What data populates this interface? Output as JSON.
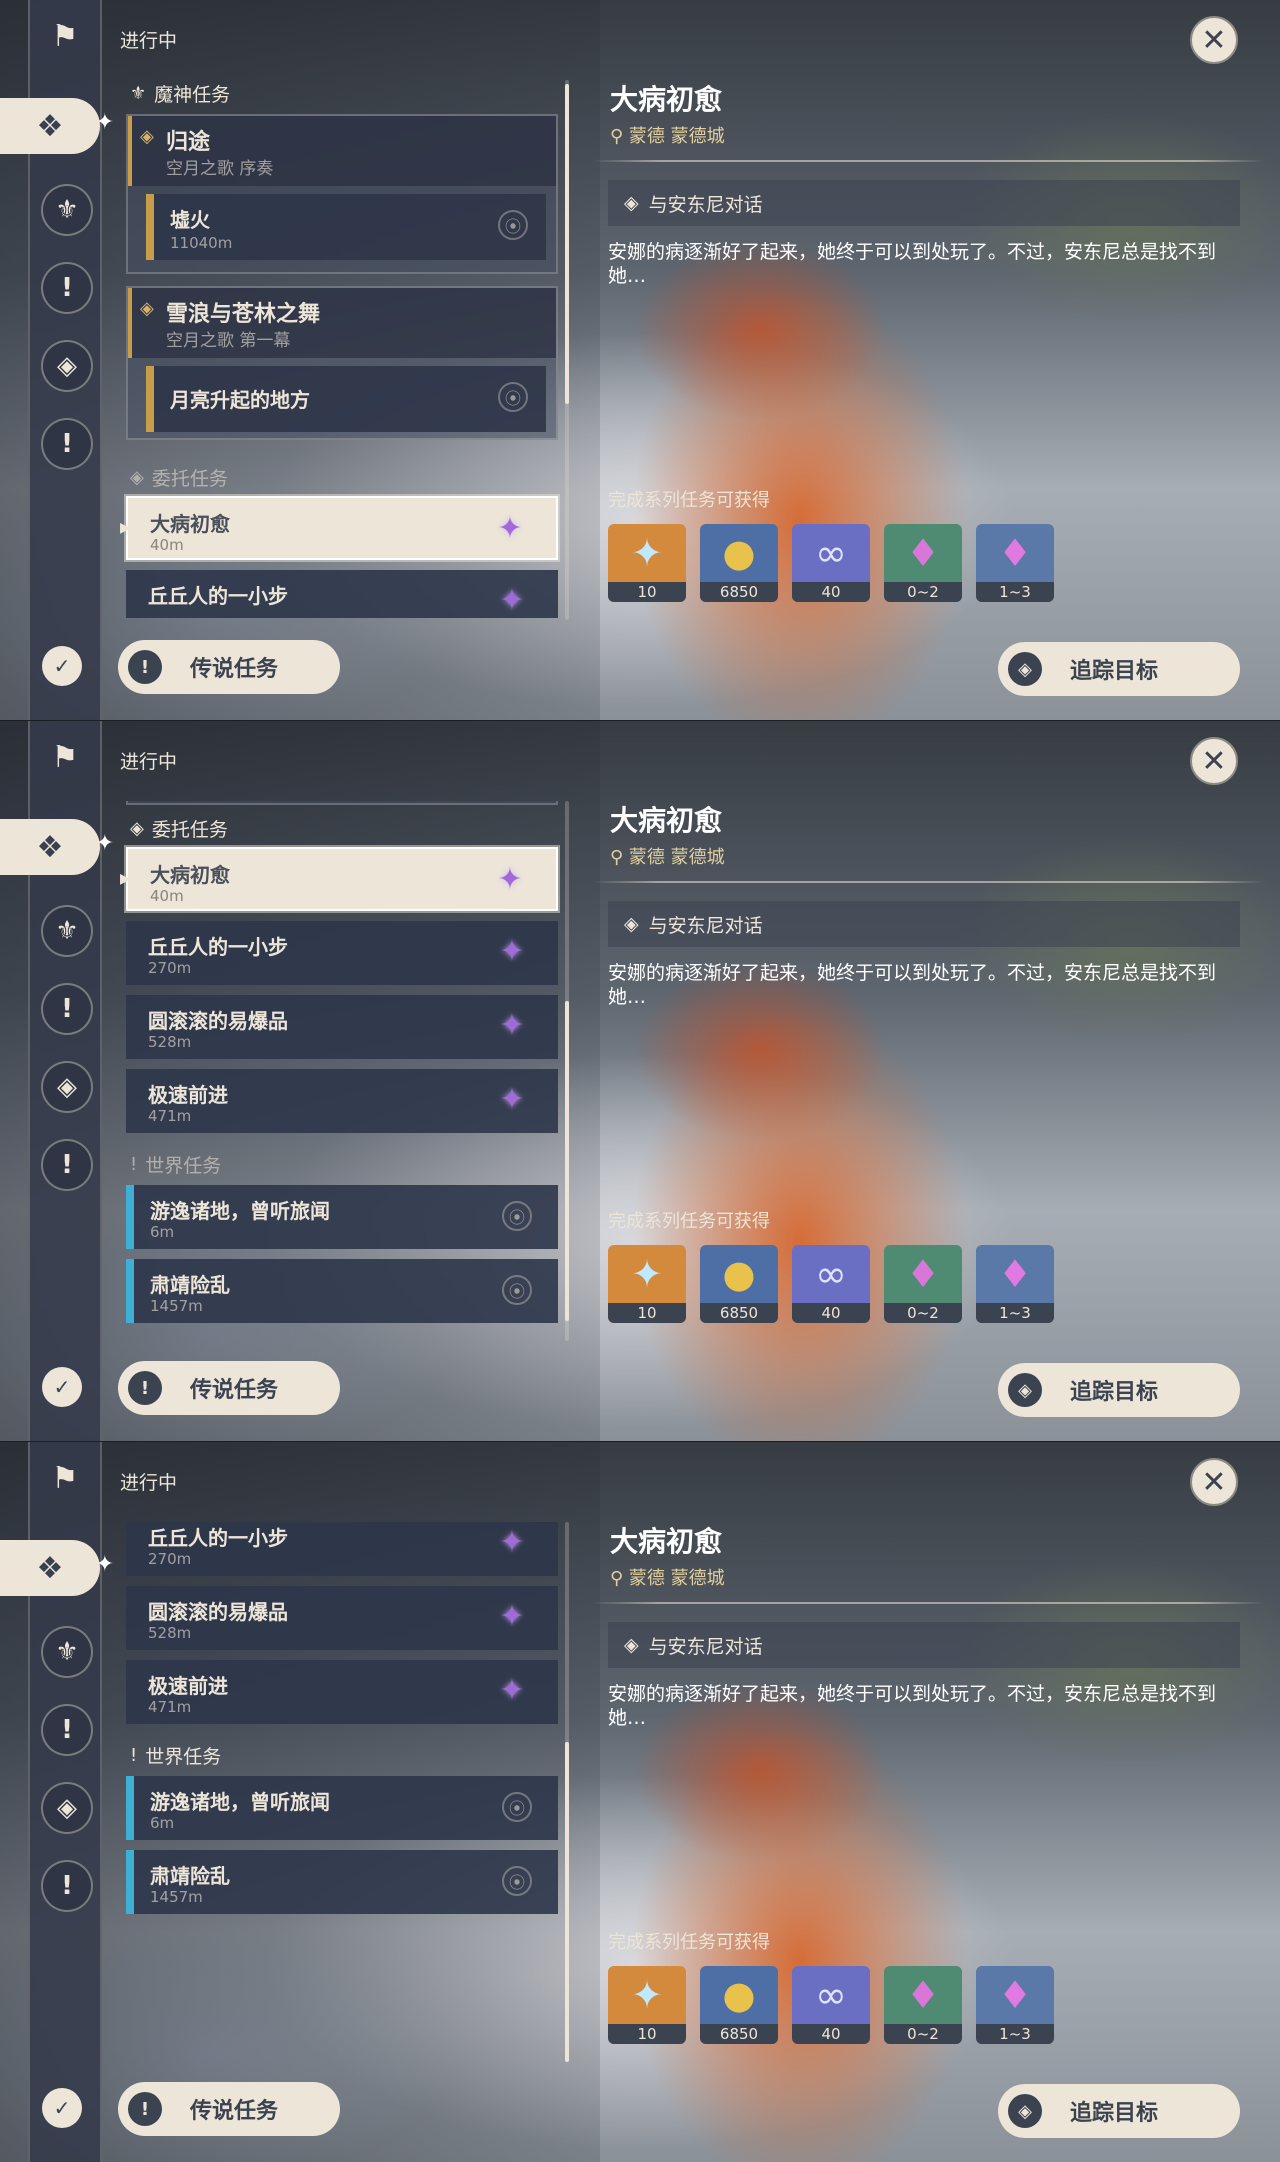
{
  "colors": {
    "cream": "#ece5d8",
    "gold": "#c89d4a",
    "world_blue": "#3eb0d6",
    "panel_dark": "#2e3648",
    "purple_icon": "#a06bd8"
  },
  "status": "进行中",
  "sidebar": {
    "icons": [
      "bookmark-flag-icon",
      "four-diamond-icon",
      "archon-quest-icon",
      "legend-quest-icon",
      "commission-icon",
      "world-quest-icon",
      "quest-log-icon"
    ]
  },
  "sections": {
    "archon": "魔神任务",
    "commission": "委托任务",
    "world": "世界任务"
  },
  "archon_groups": [
    {
      "title": "归途",
      "subtitle": "空月之歌 序奏",
      "sub_title": "墟火",
      "sub_dist": "11040m"
    },
    {
      "title": "雪浪与苍林之舞",
      "subtitle": "空月之歌 第一幕",
      "sub_title": "月亮升起的地方",
      "sub_dist": ""
    }
  ],
  "commissions": [
    {
      "title": "大病初愈",
      "dist": "40m"
    },
    {
      "title": "丘丘人的一小步",
      "dist": "270m"
    },
    {
      "title": "圆滚滚的易爆品",
      "dist": "528m"
    },
    {
      "title": "极速前进",
      "dist": "471m"
    }
  ],
  "world_quests": [
    {
      "title": "游逸诸地，曾听旅闻",
      "dist": "6m"
    },
    {
      "title": "肃靖险乱",
      "dist": "1457m"
    }
  ],
  "legend_button": "传说任务",
  "track_button": "追踪目标",
  "detail": {
    "title": "大病初愈",
    "location": "蒙德 蒙德城",
    "objective": "与安东尼对话",
    "description": "安娜的病逐渐好了起来，她终于可以到处玩了。不过，安东尼总是找不到她…",
    "rewards_label": "完成系列任务可获得",
    "rewards": [
      {
        "icon": "primogem-icon",
        "count": "10"
      },
      {
        "icon": "mora-coin-icon",
        "count": "6850"
      },
      {
        "icon": "adventure-exp-icon",
        "count": "40"
      },
      {
        "icon": "green-crystal-icon",
        "count": "0~2"
      },
      {
        "icon": "purple-crystal-icon",
        "count": "1~3"
      }
    ]
  }
}
